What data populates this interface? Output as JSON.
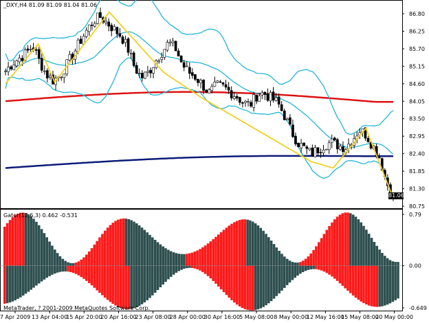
{
  "chart_window": {
    "title": "_DXY,H4  81.09 81.09 81.04 81.06",
    "indicator_title": "Gator(12,6,3) 0.462 -0.531",
    "copyright": "MetaTrader, ? 2001-2009 MetaQuotes Software Corp.",
    "current_price_label": "81.06"
  },
  "colors": {
    "background": "#ffffff",
    "bull_candle": "#ffffff",
    "bear_candle": "#000000",
    "bands": "#22b4d8",
    "zigzag": "#f0d020",
    "ma_slow_red": "#dd1111",
    "ma_slow_blue": "#0c1a78",
    "gator_up": "#ff1818",
    "gator_down": "#2f4f4f"
  },
  "chart_data": [
    {
      "type": "candlestick",
      "title": "_DXY,H4",
      "y_ticks": [
        "86.80",
        "86.25",
        "85.70",
        "85.15",
        "84.60",
        "84.05",
        "83.50",
        "82.95",
        "82.40",
        "81.85",
        "81.30",
        "80.75"
      ],
      "ylim": [
        80.75,
        86.8
      ],
      "x_ticks": [
        "7 Apr 2009",
        "13 Apr 04:00",
        "15 Apr 20:00",
        "20 Apr 16:00",
        "23 Apr 08:00",
        "28 Apr 00:00",
        "30 Apr 16:00",
        "5 May 08:00",
        "8 May 00:00",
        "12 May 16:00",
        "15 May 08:00",
        "20 May 00:00"
      ],
      "close_path": [
        85.0,
        85.25,
        85.4,
        85.55,
        85.8,
        85.3,
        84.9,
        84.7,
        84.85,
        85.2,
        85.55,
        85.95,
        86.3,
        86.6,
        86.7,
        86.5,
        86.3,
        86.1,
        85.7,
        85.1,
        84.8,
        84.95,
        85.3,
        85.6,
        85.9,
        85.7,
        85.2,
        84.95,
        84.8,
        84.55,
        84.3,
        84.55,
        84.5,
        84.35,
        84.2,
        84.0,
        83.95,
        84.25,
        84.3,
        84.15,
        84.0,
        83.6,
        83.1,
        82.75,
        82.55,
        82.4,
        82.55,
        82.7,
        82.75,
        82.65,
        82.6,
        82.85,
        83.15,
        83.0,
        82.65,
        82.3,
        81.5,
        81.05
      ],
      "series": [
        {
          "name": "Bollinger upper band",
          "line_type": "band"
        },
        {
          "name": "Bollinger middle band",
          "line_type": "band"
        },
        {
          "name": "Bollinger lower band",
          "line_type": "band"
        },
        {
          "name": "ZigZag",
          "points": [
            {
              "i": 0,
              "y": 84.6
            },
            {
              "i": 6,
              "y": 85.85
            },
            {
              "i": 9,
              "y": 84.65
            },
            {
              "i": 19,
              "y": 86.85
            },
            {
              "i": 29,
              "y": 84.95
            },
            {
              "i": 36,
              "y": 84.15
            },
            {
              "i": 56,
              "y": 82.15
            },
            {
              "i": 60,
              "y": 81.95
            },
            {
              "i": 66,
              "y": 83.2
            },
            {
              "i": 71,
              "y": 81.0
            }
          ]
        },
        {
          "name": "Moving average (red)",
          "values_start": 84.05,
          "values_peak": 84.35,
          "values_end": 84.05
        },
        {
          "name": "Moving average (blue)",
          "values_start": 81.95,
          "values_peak": 82.35,
          "values_end": 82.3
        }
      ],
      "current_price": 81.06
    },
    {
      "type": "bar",
      "title": "Gator(12,6,3)",
      "y_ticks": [
        "0.79",
        "0.00",
        "-0.649"
      ],
      "ylim": [
        -0.649,
        0.79
      ],
      "values_note": "upper histogram (positive) and lower histogram (negative) bars colored red when increasing and dark slate when decreasing"
    }
  ]
}
